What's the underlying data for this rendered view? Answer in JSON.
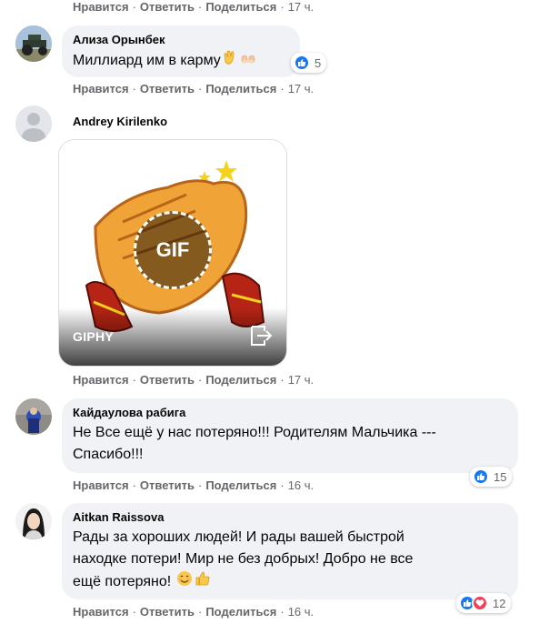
{
  "actions": {
    "like": "Нравится",
    "reply": "Ответить",
    "share": "Поделиться",
    "separator": "·"
  },
  "comments": [
    {
      "time": "17 ч."
    },
    {
      "author": "Ализа Орынбек",
      "text": "Миллиард им в карму",
      "emojis": [
        "clapping-hands-icon",
        "raised-hands-icon"
      ],
      "reactions": {
        "icons": [
          "like"
        ],
        "count": "5"
      },
      "time": "17 ч."
    },
    {
      "author": "Andrey Kirilenko",
      "gif": {
        "provider": "GIPHY",
        "badge": "GIF"
      },
      "time": "17 ч."
    },
    {
      "author": "Кайдаулова рабига",
      "text_lines": [
        "Не Все ещё у нас потеряно!!! Родителям Мальчика ---",
        "Спасибо!!!"
      ],
      "reactions": {
        "icons": [
          "like"
        ],
        "count": "15"
      },
      "time": "16 ч."
    },
    {
      "author": "Aitkan Raissova",
      "text_lines": [
        "Рады за хороших людей! И рады вашей быстрой",
        "находке потери! Мир не без добрых! Добро не все",
        "ещё потеряно!"
      ],
      "emojis": [
        "smiling-face-icon",
        "thumbs-up-icon"
      ],
      "reactions": {
        "icons": [
          "like",
          "love"
        ],
        "count": "12"
      },
      "time": "16 ч."
    }
  ],
  "colors": {
    "like_blue": "#1877f2",
    "love_red": "#f33e58",
    "bubble_bg": "#f0f2f5",
    "meta_gray": "#65676b"
  }
}
